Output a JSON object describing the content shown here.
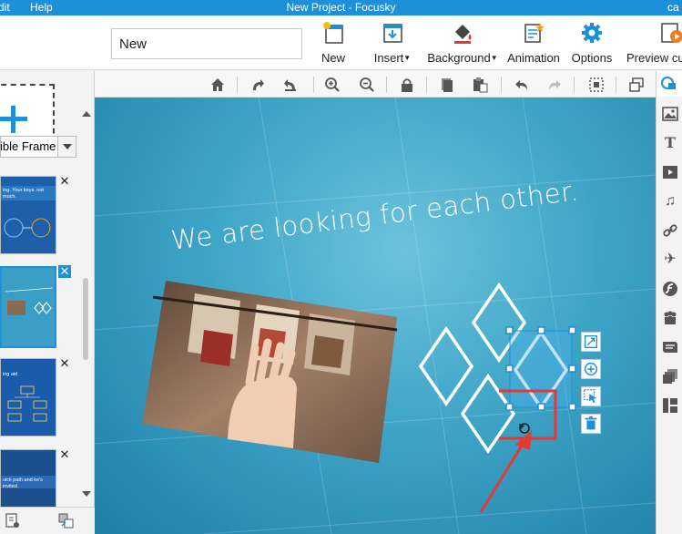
{
  "window": {
    "title": "New Project - Focusky",
    "menu": [
      "dit",
      "Help"
    ],
    "right_text": "ca"
  },
  "toolbar": {
    "project_name": "New",
    "buttons": [
      {
        "label": "New"
      },
      {
        "label": "Insert"
      },
      {
        "label": "Background"
      },
      {
        "label": "Animation"
      },
      {
        "label": "Options"
      },
      {
        "label": "Preview cu"
      }
    ]
  },
  "left_panel": {
    "frame_type": "ible Frame",
    "thumbnails": [
      {
        "text": "ing. Your keys. not much."
      },
      {
        "text": "",
        "selected": true
      },
      {
        "text": "ing aid"
      },
      {
        "text": "uick path and ke's invited"
      }
    ]
  },
  "canvas": {
    "headline": "We are looking for each other."
  },
  "colors": {
    "accent": "#1e8fd9",
    "titlebar": "#1e8fd9",
    "highlight_box": "#e53935"
  }
}
